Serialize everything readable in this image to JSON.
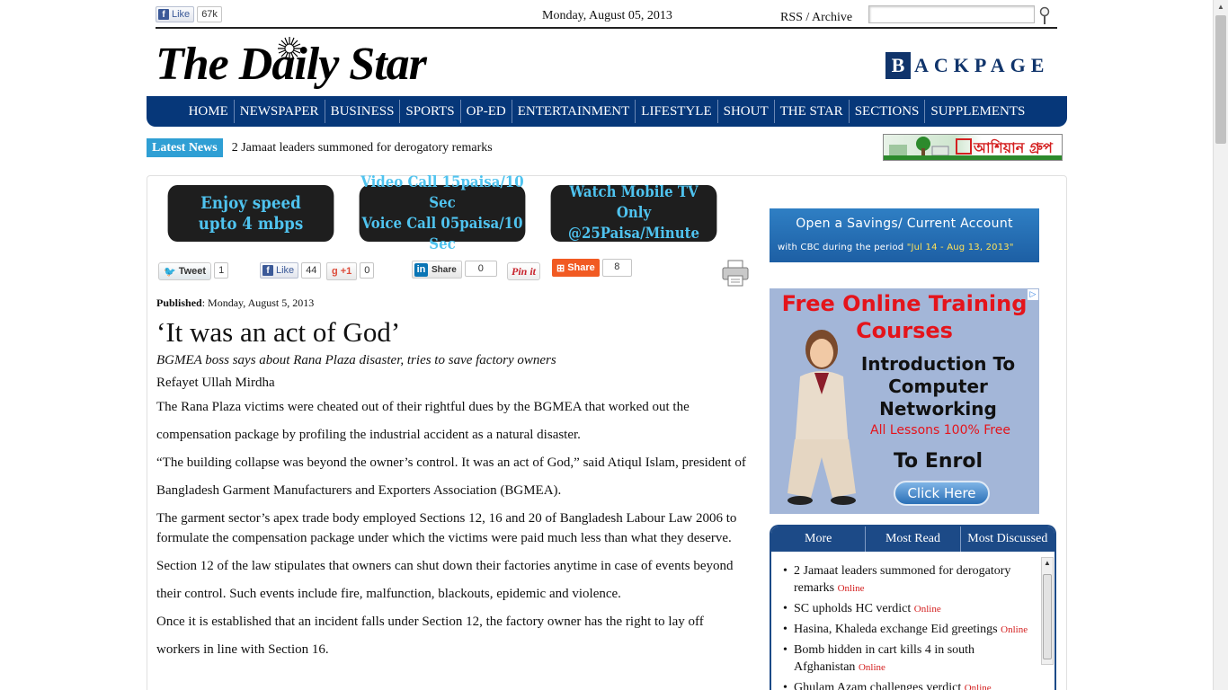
{
  "topbar": {
    "fb_like_label": "Like",
    "fb_like_count": "67k",
    "date": "Monday, August 05, 2013",
    "rss_archive": "RSS / Archive",
    "search_placeholder": ""
  },
  "logo": {
    "text": "The Daily Star"
  },
  "backpage": {
    "first_letter": "B",
    "rest": "ACKPAGE"
  },
  "nav": {
    "items": [
      "HOME",
      "NEWSPAPER",
      "BUSINESS",
      "SPORTS",
      "OP-ED",
      "ENTERTAINMENT",
      "LIFESTYLE",
      "SHOUT",
      "THE STAR",
      "SECTIONS",
      "SUPPLEMENTS"
    ]
  },
  "latest_news": {
    "label": "Latest News",
    "headline": "2 Jamaat leaders summoned for derogatory remarks"
  },
  "top_ad": {
    "text": "আশিয়ান গ্রুপ"
  },
  "promos": [
    {
      "line1": "Enjoy speed",
      "line2": "upto 4 mbps"
    },
    {
      "line1": "Video Call 15paisa/10 Sec",
      "line2": "Voice Call 05paisa/10 Sec"
    },
    {
      "line1": "Watch Mobile TV",
      "line2": "Only @25Paisa/Minute"
    }
  ],
  "share": {
    "tweet_label": "Tweet",
    "tweet_count": "1",
    "like_label": "Like",
    "like_count": "44",
    "gplus_label": "+1",
    "gplus_count": "0",
    "linkedin_label": "Share",
    "linkedin_count": "0",
    "pinit_label": "Pin it",
    "share_label": "Share",
    "share_count": "8"
  },
  "article": {
    "published_label": "Published",
    "published_date": ": Monday, August 5, 2013",
    "headline": "‘It was an act of God’",
    "subhead": "BGMEA boss says about Rana Plaza disaster, tries to save factory owners",
    "author": "Refayet Ullah Mirdha",
    "paragraphs": [
      "The Rana Plaza victims were cheated out of their rightful dues by the BGMEA that worked out the compensation package by profiling the industrial accident as a natural disaster.",
      "“The building collapse was beyond the owner’s control. It was an act of God,” said Atiqul Islam, president of Bangladesh Garment Manufacturers and Exporters Association (BGMEA).",
      "The garment sector’s apex trade body employed Sections 12, 16 and 20 of Bangladesh Labour Law 2006 to formulate the compensation package under which the victims were paid much less than what they deserve.",
      "Section 12 of the law stipulates that owners can shut down their factories anytime in case of events beyond their control. Such events include fire, malfunction, blackouts, epidemic and violence.",
      "Once it is established that an incident falls under Section 12, the factory owner has the right to lay off workers in line with Section 16."
    ]
  },
  "cbc_ad": {
    "line1": "Open a Savings/ Current Account",
    "line2_prefix": "with CBC during the period ",
    "line2_period": "\"Jul 14 - Aug 13, 2013\""
  },
  "training_ad": {
    "title": "Free Online Training Courses",
    "subtitle": "Introduction To Computer Networking",
    "free_line": "All Lessons 100% Free",
    "enrol": "To Enrol",
    "button": "Click Here",
    "corner": "▷"
  },
  "tabs": {
    "labels": [
      "More",
      "Most Read",
      "Most Discussed"
    ],
    "items": [
      {
        "title": "2 Jamaat leaders summoned for derogatory remarks",
        "tag": "Online"
      },
      {
        "title": "SC upholds HC verdict",
        "tag": "Online"
      },
      {
        "title": "Hasina, Khaleda exchange Eid greetings",
        "tag": "Online"
      },
      {
        "title": "Bomb hidden in cart kills 4 in south Afghanistan",
        "tag": "Online"
      },
      {
        "title": "Ghulam Azam challenges verdict",
        "tag": "Online"
      }
    ]
  },
  "colors": {
    "nav_blue": "#063779",
    "latest_blue": "#2f9fd4",
    "promo_text": "#4fc3ef",
    "online_red": "#d42020"
  }
}
